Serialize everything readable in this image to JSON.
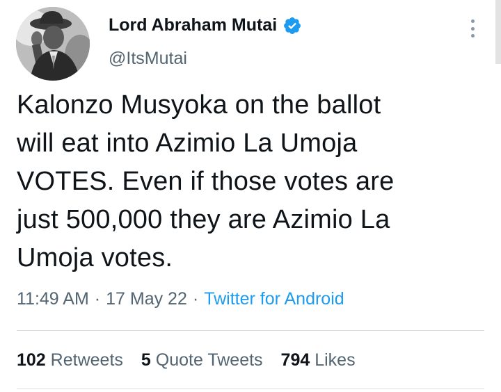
{
  "author": {
    "display_name": "Lord Abraham Mutai",
    "handle": "@ItsMutai",
    "verified": true,
    "verified_icon": "verified-badge-icon",
    "verified_color": "#1d9bf0"
  },
  "menu": {
    "icon": "more-vertical-icon"
  },
  "tweet": {
    "text": "Kalonzo Musyoka on the ballot\nwill eat into Azimio La Umoja\nVOTES. Even if those votes are\njust 500,000 they are Azimio La\nUmoja votes.",
    "time": "11:49 AM",
    "date": "17 May 22",
    "separator": "·",
    "source": "Twitter for Android"
  },
  "stats": {
    "retweets": {
      "count": "102",
      "label": "Retweets"
    },
    "quote_tweets": {
      "count": "5",
      "label": "Quote Tweets"
    },
    "likes": {
      "count": "794",
      "label": "Likes"
    }
  },
  "colors": {
    "text_primary": "#0f1419",
    "text_secondary": "#536471",
    "link": "#1d9bf0",
    "divider": "#d9dde1"
  }
}
